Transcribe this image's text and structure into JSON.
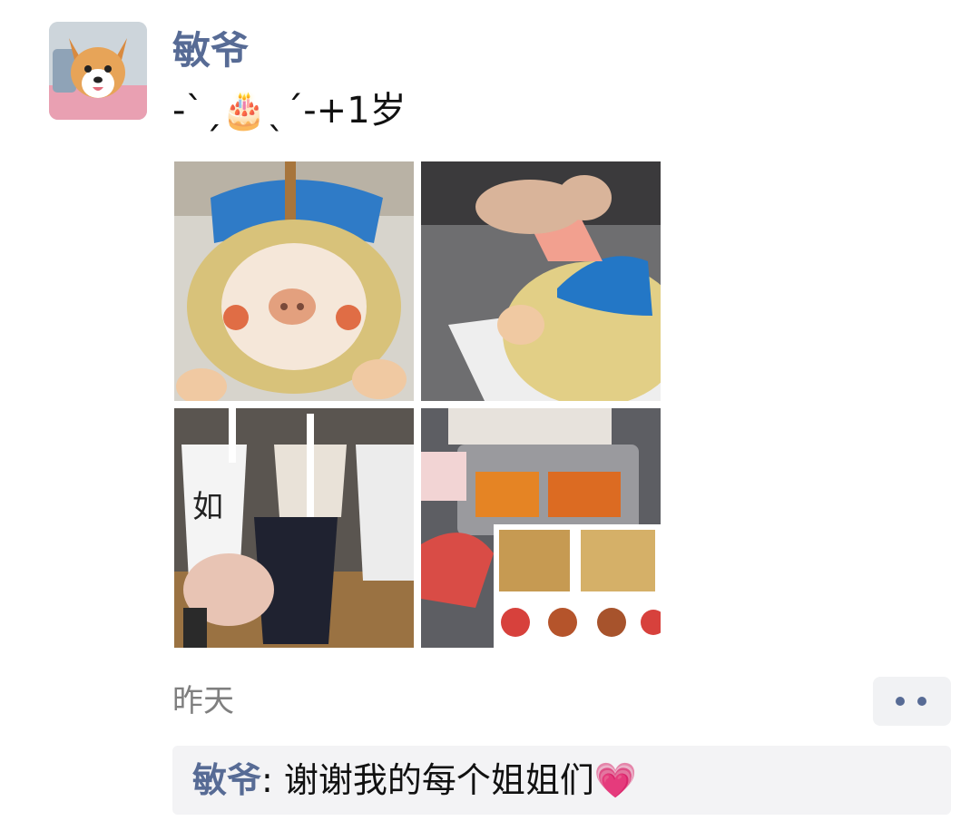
{
  "post": {
    "author": "敏爷",
    "text": "-ˋˏ🎂ˎˊ-+1岁",
    "timestamp": "昨天",
    "avatar": "corgi-avatar",
    "photos": [
      {
        "name": "cake-pig-front"
      },
      {
        "name": "cake-cutting"
      },
      {
        "name": "milk-tea-cups"
      },
      {
        "name": "hotpot-table"
      }
    ],
    "more_button_icon": "two-dots-icon"
  },
  "comments": [
    {
      "name": "敏爷",
      "separator": ": ",
      "text": "谢谢我的每个姐姐们💗"
    }
  ],
  "colors": {
    "link": "#576b95",
    "text": "#111111",
    "meta": "#7f7f7f",
    "comment_bg": "#f3f3f5"
  }
}
